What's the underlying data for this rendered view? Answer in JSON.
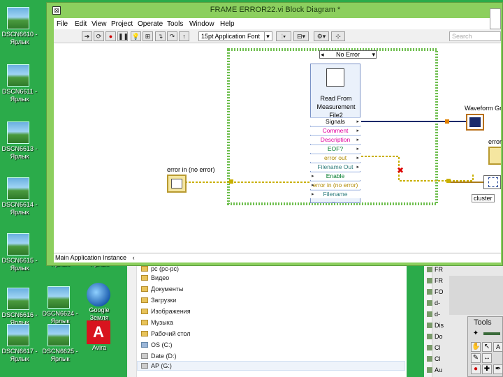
{
  "desktop": {
    "icons": [
      {
        "label": "DSCN6610 -\nЯрлык"
      },
      {
        "label": "DSCN6611 -\nЯрлык"
      },
      {
        "label": "DSCN6613 -\nЯрлык"
      },
      {
        "label": "DSCN6614 -\nЯрлык"
      },
      {
        "label": "DSCN6615 -\nЯрлык"
      },
      {
        "label": "DSCN6616 -\nЯрлык"
      },
      {
        "label": "DSCN6617 -\nЯрлык"
      },
      {
        "label": "Ярлык"
      },
      {
        "label": "Ярлык"
      },
      {
        "label": "DSCN6624 -\nЯрлык"
      },
      {
        "label": "DSCN6625 -\nЯрлык"
      },
      {
        "label": "Google\nЗемля"
      },
      {
        "label": "Avira"
      }
    ]
  },
  "window": {
    "title": "FRAME ERROR22.vi Block Diagram *",
    "menu": [
      "File",
      "Edit",
      "View",
      "Project",
      "Operate",
      "Tools",
      "Window",
      "Help"
    ],
    "font_select": "15pt Application Font",
    "search_placeholder": "Search",
    "status": "Main Application Instance"
  },
  "diagram": {
    "case_selector": "No Error",
    "express_vi": {
      "title": "Read From Measurement File2",
      "terminals": [
        {
          "label": "Signals",
          "color": "#000000"
        },
        {
          "label": "Comment",
          "color": "#e000a0"
        },
        {
          "label": "Description",
          "color": "#e000a0"
        },
        {
          "label": "EOF?",
          "color": "#007a2a"
        },
        {
          "label": "error out",
          "color": "#c8a000"
        },
        {
          "label": "Filename Out",
          "color": "#2a8a8a"
        },
        {
          "label": "Enable",
          "color": "#007a2a"
        },
        {
          "label": "error in (no error)",
          "color": "#c8a000"
        },
        {
          "label": "Filename",
          "color": "#2a8a8a"
        }
      ]
    },
    "error_in_label": "error in (no error)",
    "waveform_label": "Waveform Gr",
    "error_out_label": "error",
    "cluster_label": "cluster"
  },
  "explorer": {
    "items": [
      {
        "label": "pc (pc-pc)"
      },
      {
        "label": "Видео"
      },
      {
        "label": "Документы"
      },
      {
        "label": "Загрузки"
      },
      {
        "label": "Изображения"
      },
      {
        "label": "Музыка"
      },
      {
        "label": "Рабочий стол"
      },
      {
        "label": "OS (C:)"
      },
      {
        "label": "Date (D:)"
      },
      {
        "label": "AP (G:)"
      }
    ]
  },
  "right_list": [
    "FR",
    "FR",
    "FO",
    "d-",
    "d-",
    "Dis",
    "Do",
    "Cl",
    "Cl",
    "Au"
  ],
  "tools_palette": {
    "title": "Tools"
  }
}
